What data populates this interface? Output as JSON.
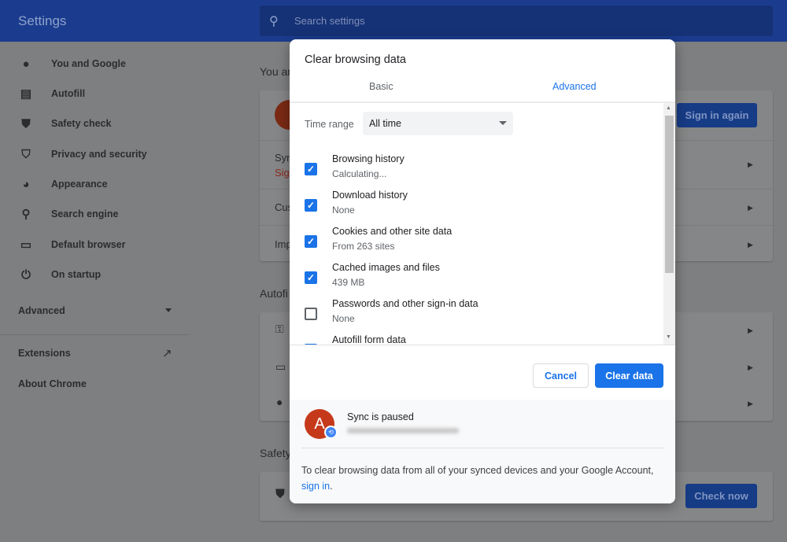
{
  "header": {
    "title": "Settings",
    "search_placeholder": "Search settings",
    "search_icon": "search-icon"
  },
  "sidebar": {
    "items": [
      {
        "label": "You and Google",
        "icon": "person-icon"
      },
      {
        "label": "Autofill",
        "icon": "clipboard-icon"
      },
      {
        "label": "Safety check",
        "icon": "shield-check-icon"
      },
      {
        "label": "Privacy and security",
        "icon": "shield-half-icon"
      },
      {
        "label": "Appearance",
        "icon": "palette-icon"
      },
      {
        "label": "Search engine",
        "icon": "search-icon"
      },
      {
        "label": "Default browser",
        "icon": "browser-icon"
      },
      {
        "label": "On startup",
        "icon": "power-icon"
      }
    ],
    "advanced": "Advanced",
    "extensions": "Extensions",
    "about": "About Chrome"
  },
  "background": {
    "you_section": "You ar",
    "sync_row": "Syn",
    "sync_sub": "Sig",
    "cust_row": "Cus",
    "imp_row": "Imp",
    "sign_in_again": "Sign in again",
    "autofill_section": "Autofi",
    "safety_section": "Safety",
    "check_now": "Check now"
  },
  "dialog": {
    "title": "Clear browsing data",
    "tabs": [
      {
        "label": "Basic",
        "active": false
      },
      {
        "label": "Advanced",
        "active": true
      }
    ],
    "time_range_label": "Time range",
    "time_range_value": "All time",
    "options": [
      {
        "label": "Browsing history",
        "detail": "Calculating...",
        "checked": true
      },
      {
        "label": "Download history",
        "detail": "None",
        "checked": true
      },
      {
        "label": "Cookies and other site data",
        "detail": "From 263 sites",
        "checked": true
      },
      {
        "label": "Cached images and files",
        "detail": "439 MB",
        "checked": true
      },
      {
        "label": "Passwords and other sign-in data",
        "detail": "None",
        "checked": false
      },
      {
        "label": "Autofill form data",
        "detail": "",
        "checked": true
      }
    ],
    "cancel": "Cancel",
    "clear": "Clear data",
    "sync": {
      "avatar_letter": "A",
      "status": "Sync is paused",
      "note": "To clear browsing data from all of your synced devices and your Google Account,",
      "link": "sign in",
      "link_suffix": "."
    }
  },
  "colors": {
    "accent": "#1a73e8",
    "header": "#1b3c8e",
    "avatar": "#c5391a"
  }
}
